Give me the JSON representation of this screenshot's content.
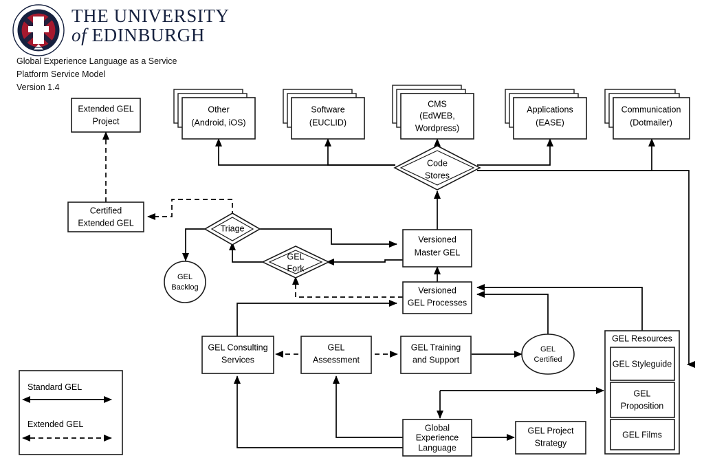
{
  "header": {
    "org_line1": "THE UNIVERSITY",
    "org_of": "of",
    "org_line2": "EDINBURGH",
    "crest_icon": "university-crest-icon",
    "subtitle_1": "Global Experience Language as a Service",
    "subtitle_2": "Platform Service Model",
    "subtitle_3": "Version 1.4"
  },
  "legend": {
    "standard_label": "Standard GEL",
    "extended_label": "Extended GEL",
    "standard_arrow_icon": "solid-double-arrow-icon",
    "extended_arrow_icon": "dashed-double-arrow-icon"
  },
  "nodes": {
    "extended_gel_project": {
      "line1": "Extended GEL",
      "line2": "Project"
    },
    "other": {
      "line1": "Other",
      "line2": "(Android, iOS)"
    },
    "software": {
      "line1": "Software",
      "line2": "(EUCLID)"
    },
    "cms": {
      "line1": "CMS",
      "line2": "(EdWEB,",
      "line3": "Wordpress)"
    },
    "applications": {
      "line1": "Applications",
      "line2": "(EASE)"
    },
    "communication": {
      "line1": "Communication",
      "line2": "(Dotmailer)"
    },
    "code_stores": {
      "line1": "Code",
      "line2": "Stores"
    },
    "certified_extended_gel": {
      "line1": "Certified",
      "line2": "Extended GEL"
    },
    "triage": {
      "line1": "Triage"
    },
    "gel_backlog": {
      "line1": "GEL",
      "line2": "Backlog"
    },
    "gel_fork": {
      "line1": "GEL",
      "line2": "Fork"
    },
    "versioned_master_gel": {
      "line1": "Versioned",
      "line2": "Master GEL"
    },
    "versioned_gel_processes": {
      "line1": "Versioned",
      "line2": "GEL Processes"
    },
    "gel_consulting_services": {
      "line1": "GEL Consulting",
      "line2": "Services"
    },
    "gel_assessment": {
      "line1": "GEL",
      "line2": "Assessment"
    },
    "gel_training_and_support": {
      "line1": "GEL Training",
      "line2": "and Support"
    },
    "gel_certified": {
      "line1": "GEL",
      "line2": "Certified"
    },
    "gel_resources": {
      "title": "GEL Resources"
    },
    "gel_styleguide": {
      "line1": "GEL Styleguide"
    },
    "gel_proposition": {
      "line1": "GEL",
      "line2": "Proposition"
    },
    "gel_films": {
      "line1": "GEL Films"
    },
    "global_experience_language": {
      "line1": "Global",
      "line2": "Experience",
      "line3": "Language"
    },
    "gel_project_strategy": {
      "line1": "GEL Project",
      "line2": "Strategy"
    }
  },
  "colors": {
    "stroke": "#1c1c1c",
    "line": "#000000",
    "brand_navy": "#16213f",
    "crest_red": "#a6192e",
    "background": "#ffffff"
  }
}
